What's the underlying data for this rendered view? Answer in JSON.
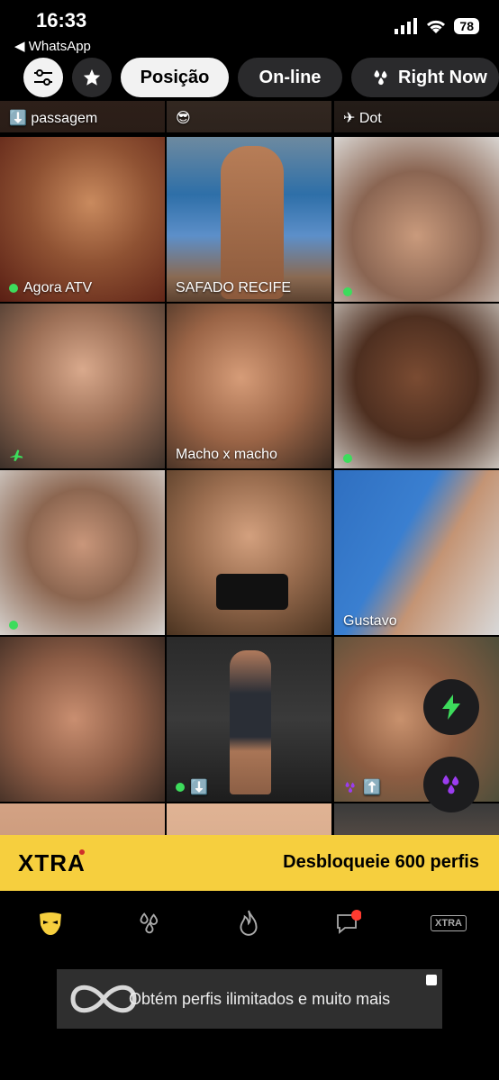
{
  "status": {
    "time": "16:33",
    "back_label": "◀ WhatsApp",
    "battery": "78"
  },
  "filters": {
    "position": "Posição",
    "online": "On-line",
    "right_now": "Right Now"
  },
  "row0": [
    "⬇️ passagem",
    "😎",
    "✈ Dot"
  ],
  "cells": [
    {
      "caption": "Agora ATV",
      "online": true
    },
    {
      "caption": "SAFADO RECIFE",
      "online": false
    },
    {
      "caption": "",
      "online": true
    },
    {
      "caption": "",
      "online": false,
      "plane": true
    },
    {
      "caption": "Macho x macho",
      "online": false
    },
    {
      "caption": "",
      "online": true
    },
    {
      "caption": "",
      "online": true
    },
    {
      "caption": "",
      "online": false
    },
    {
      "caption": "Gustavo",
      "online": false
    },
    {
      "caption": "",
      "online": false
    },
    {
      "caption": "⬇️",
      "online": true
    },
    {
      "caption": "⬆️",
      "online": false,
      "drops": true
    }
  ],
  "xtra": {
    "logo": "XTRA",
    "cta": "Desbloqueie 600 perfis"
  },
  "tabs": {
    "xtra_label": "XTRA"
  },
  "ad": {
    "text": "Obtém perfis ilimitados e muito mais"
  },
  "colors": {
    "accent_yellow": "#f6cf3e",
    "online_green": "#3ddc5c",
    "notify_red": "#ff3b30",
    "purple": "#9b3cf0"
  }
}
